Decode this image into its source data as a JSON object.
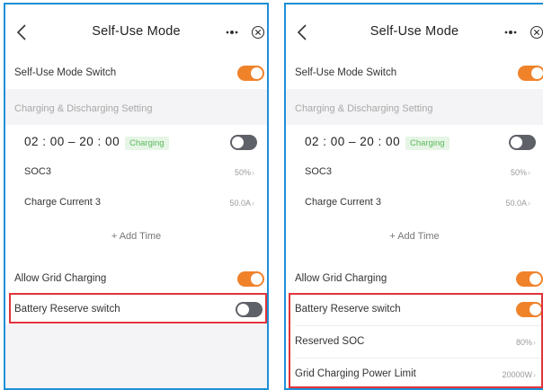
{
  "screens": [
    {
      "title": "Self-Use Mode",
      "icons": {
        "back": "chevron-left-icon",
        "more": "more-dots-icon",
        "close": "close-circle-icon"
      },
      "self_use_switch": {
        "label": "Self-Use Mode Switch",
        "on": true
      },
      "section_label": "Charging & Discharging Setting",
      "time_slot": {
        "time": "02 : 00 – 20 : 00",
        "badge": "Charging",
        "on": false
      },
      "soc": {
        "label": "SOC3",
        "value": "50%"
      },
      "charge_current": {
        "label": "Charge Current 3",
        "value": "50.0A"
      },
      "add_time": "+ Add Time",
      "allow_grid": {
        "label": "Allow Grid Charging",
        "on": true
      },
      "battery_reserve": {
        "label": "Battery Reserve switch",
        "on": false
      }
    },
    {
      "title": "Self-Use Mode",
      "icons": {
        "back": "chevron-left-icon",
        "more": "more-dots-icon",
        "close": "close-circle-icon"
      },
      "self_use_switch": {
        "label": "Self-Use Mode Switch",
        "on": true
      },
      "section_label": "Charging & Discharging Setting",
      "time_slot": {
        "time": "02 : 00 – 20 : 00",
        "badge": "Charging",
        "on": false
      },
      "soc": {
        "label": "SOC3",
        "value": "50%"
      },
      "charge_current": {
        "label": "Charge Current 3",
        "value": "50.0A"
      },
      "add_time": "+ Add Time",
      "allow_grid": {
        "label": "Allow Grid Charging",
        "on": true
      },
      "battery_reserve": {
        "label": "Battery Reserve switch",
        "on": true
      },
      "reserved_soc": {
        "label": "Reserved SOC",
        "value": "80%"
      },
      "grid_power_limit": {
        "label": "Grid Charging Power Limit",
        "value": "20000W"
      }
    }
  ],
  "colors": {
    "accent": "#f0822a",
    "frame": "#1e8fd6",
    "highlight": "#e0343a",
    "badge": "#5cb85c"
  },
  "chevron": "›"
}
